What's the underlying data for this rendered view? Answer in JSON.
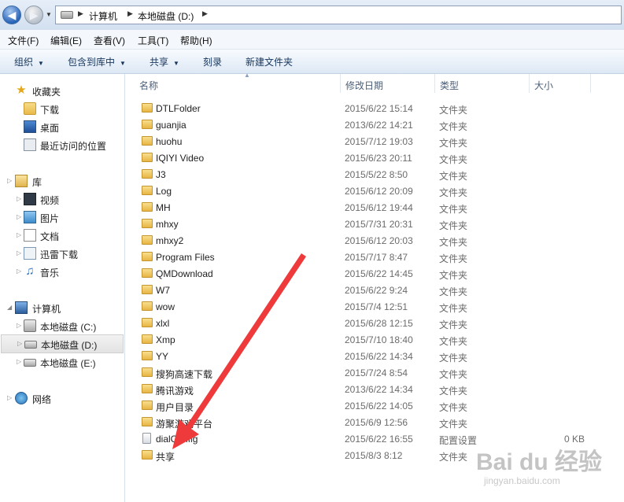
{
  "address": {
    "crumbs": [
      "计算机",
      "本地磁盘 (D:)"
    ]
  },
  "menu": [
    "文件(F)",
    "编辑(E)",
    "查看(V)",
    "工具(T)",
    "帮助(H)"
  ],
  "toolbar": {
    "organize": "组织",
    "include_library": "包含到库中",
    "share": "共享",
    "burn": "刻录",
    "new_folder": "新建文件夹"
  },
  "nav": {
    "favorites": "收藏夹",
    "downloads": "下载",
    "desktop": "桌面",
    "recent": "最近访问的位置",
    "libraries": "库",
    "videos": "视频",
    "pictures": "图片",
    "documents": "文档",
    "thunder": "迅雷下载",
    "music": "音乐",
    "computer": "计算机",
    "drive_c": "本地磁盘 (C:)",
    "drive_d": "本地磁盘 (D:)",
    "drive_e": "本地磁盘 (E:)",
    "network": "网络"
  },
  "columns": {
    "name": "名称",
    "modified": "修改日期",
    "type": "类型",
    "size": "大小"
  },
  "files": [
    {
      "name": "DTLFolder",
      "date": "2015/6/22 15:14",
      "type": "文件夹",
      "size": ""
    },
    {
      "name": "guanjia",
      "date": "2013/6/22 14:21",
      "type": "文件夹",
      "size": ""
    },
    {
      "name": "huohu",
      "date": "2015/7/12 19:03",
      "type": "文件夹",
      "size": ""
    },
    {
      "name": "IQIYI Video",
      "date": "2015/6/23 20:11",
      "type": "文件夹",
      "size": ""
    },
    {
      "name": "J3",
      "date": "2015/5/22 8:50",
      "type": "文件夹",
      "size": ""
    },
    {
      "name": "Log",
      "date": "2015/6/12 20:09",
      "type": "文件夹",
      "size": ""
    },
    {
      "name": "MH",
      "date": "2015/6/12 19:44",
      "type": "文件夹",
      "size": ""
    },
    {
      "name": "mhxy",
      "date": "2015/7/31 20:31",
      "type": "文件夹",
      "size": ""
    },
    {
      "name": "mhxy2",
      "date": "2015/6/12 20:03",
      "type": "文件夹",
      "size": ""
    },
    {
      "name": "Program Files",
      "date": "2015/7/17 8:47",
      "type": "文件夹",
      "size": ""
    },
    {
      "name": "QMDownload",
      "date": "2015/6/22 14:45",
      "type": "文件夹",
      "size": ""
    },
    {
      "name": "W7",
      "date": "2015/6/22 9:24",
      "type": "文件夹",
      "size": ""
    },
    {
      "name": "wow",
      "date": "2015/7/4 12:51",
      "type": "文件夹",
      "size": ""
    },
    {
      "name": "xlxl",
      "date": "2015/6/28 12:15",
      "type": "文件夹",
      "size": ""
    },
    {
      "name": "Xmp",
      "date": "2015/7/10 18:40",
      "type": "文件夹",
      "size": ""
    },
    {
      "name": "YY",
      "date": "2015/6/22 14:34",
      "type": "文件夹",
      "size": ""
    },
    {
      "name": "搜狗高速下载",
      "date": "2015/7/24 8:54",
      "type": "文件夹",
      "size": ""
    },
    {
      "name": "腾讯游戏",
      "date": "2013/6/22 14:34",
      "type": "文件夹",
      "size": ""
    },
    {
      "name": "用户目录",
      "date": "2015/6/22 14:05",
      "type": "文件夹",
      "size": ""
    },
    {
      "name": "游聚游戏平台",
      "date": "2015/6/9 12:56",
      "type": "文件夹",
      "size": ""
    },
    {
      "name": "dialConfig",
      "date": "2015/6/22 16:55",
      "type": "配置设置",
      "size": "0 KB"
    },
    {
      "name": "共享",
      "date": "2015/8/3 8:12",
      "type": "文件夹",
      "size": ""
    }
  ],
  "watermark": {
    "brand": "Bai du 经验",
    "url": "jingyan.baidu.com"
  },
  "colors": {
    "annotation_arrow": "#ee3a3a",
    "selected_bg": "#e3e3e3",
    "toolbar_text": "#17365d"
  }
}
